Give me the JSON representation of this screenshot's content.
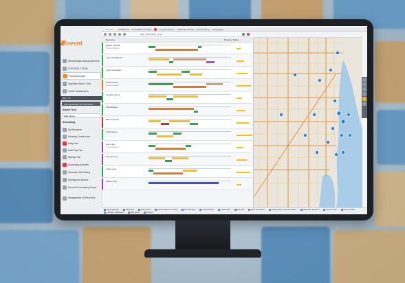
{
  "brand": {
    "logo_text": "ovent",
    "accent": "#f08a24"
  },
  "tabs": [
    {
      "label": "Daily Plan",
      "active": true
    },
    {
      "label": "Dashboard"
    },
    {
      "label": "Schedulable Activities"
    },
    {
      "label": "Urgent Activities",
      "alert": true
    },
    {
      "label": "Search Technician"
    },
    {
      "label": "Reprocessing"
    },
    {
      "label": "Daily Report"
    }
  ],
  "toolbar": {
    "date_label": "Wed. 07/07/2021 - 1:42"
  },
  "columns": {
    "resource": "Resource",
    "progress": "Progress Status"
  },
  "sidebar": {
    "items": [
      {
        "label": "Administration Announcements"
      },
      {
        "label": "07/07/2021 7:35:35"
      },
      {
        "label": "Field Messenger"
      },
      {
        "label": "Operation Admin Tools"
      },
      {
        "label": "Virtual Collaboration"
      }
    ],
    "dark_bar": "ALL - FL",
    "selector": "Fort Lauderdale / FL Technician",
    "section_search": "Search Tech",
    "search_value": "Walt Disney",
    "section_scheduling": "Scheduling",
    "sched_items": [
      {
        "label": "Set Resource"
      },
      {
        "label": "Planning Construction"
      },
      {
        "label": "Daily Plan"
      },
      {
        "label": "Multi Day Plan"
      },
      {
        "label": "Weekly Plan"
      },
      {
        "label": "Accounting Activities"
      },
      {
        "label": "Automatic Scheduling"
      },
      {
        "label": "Routing and Monitor"
      },
      {
        "label": "Demand Forecasting Report"
      }
    ],
    "footer": "Management of Resources"
  },
  "rows": [
    {
      "name": "Robert Thomas",
      "sub": "Cruise Region",
      "color": "#2aa84a"
    },
    {
      "name": "Jerry Christiansen",
      "sub": "",
      "color": "#2aa84a"
    },
    {
      "name": "Jessie Alexander",
      "sub": "",
      "color": "#2aa84a"
    },
    {
      "name": "David Pearce",
      "sub": "Cruise Region",
      "color": "#e07a1f"
    },
    {
      "name": "Jonathon Perry",
      "sub": "",
      "color": "#2aa84a"
    },
    {
      "name": "Tina Marston",
      "sub": "",
      "color": "#2aa84a"
    },
    {
      "name": "Mike Hancock",
      "sub": "",
      "color": "#c0392b"
    },
    {
      "name": "Frank Evans",
      "sub": "",
      "color": "#2aa84a"
    },
    {
      "name": "Liam Hall",
      "sub": "Cruise Region",
      "color": "#8e44ad"
    },
    {
      "name": "Jeremy Cruz",
      "sub": "",
      "color": "#8e44ad"
    },
    {
      "name": "Justin Lane",
      "sub": "",
      "color": "#2aa84a"
    },
    {
      "name": "Wilson Hunt",
      "sub": "",
      "color": "#8e44ad"
    }
  ],
  "bottom_actions": [
    {
      "label": "Show Calendar"
    },
    {
      "label": "Messages"
    },
    {
      "label": "Work Orders"
    },
    {
      "label": "Report Resource for Day"
    },
    {
      "label": "Tech Handling"
    },
    {
      "label": "Activity Report"
    },
    {
      "label": "Search WO"
    },
    {
      "label": "New WO"
    },
    {
      "label": "Mark Technicians"
    },
    {
      "label": "Change Dept. Operation Status"
    },
    {
      "label": "Daily Plan Snapshot"
    },
    {
      "label": "Route Tooltip"
    },
    {
      "label": "Search Tooltip"
    },
    {
      "label": "Utilization Dashboard"
    },
    {
      "label": "Help Status"
    },
    {
      "label": "Refresh"
    }
  ]
}
